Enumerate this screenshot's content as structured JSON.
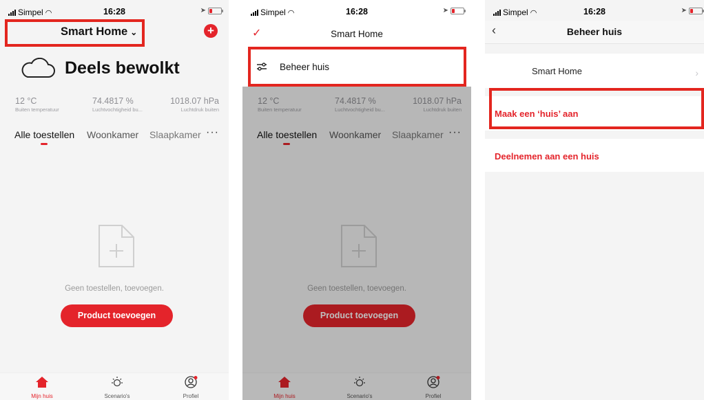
{
  "status_bar": {
    "carrier": "Simpel",
    "time": "16:28"
  },
  "screen1": {
    "home_title": "Smart Home",
    "weather_text": "Deels bewolkt",
    "stats": [
      {
        "value": "12 °C",
        "label": "Buiten temperatuur"
      },
      {
        "value": "74.4817 %",
        "label": "Luchtvochtigheid bu..."
      },
      {
        "value": "1018.07 hPa",
        "label": "Luchtdruk buiten"
      }
    ],
    "tabs": [
      "Alle toestellen",
      "Woonkamer",
      "Slaapkamer"
    ],
    "more_label": "···",
    "empty_text": "Geen toestellen, toevoegen.",
    "add_product": "Product toevoegen",
    "tabbar": [
      "Mijn huis",
      "Scenario's",
      "Profiel"
    ]
  },
  "screen2": {
    "title": "Smart Home",
    "menu_item": "Beheer huis"
  },
  "screen3": {
    "title": "Beheer huis",
    "home_row": "Smart Home",
    "create_home": "Maak een ‘huis’ aan",
    "join_home": "Deelnemen aan een huis"
  },
  "colors": {
    "accent": "#e4242b",
    "highlight_box": "#e3261f"
  },
  "icons": [
    "signal-icon",
    "wifi-icon",
    "location-icon",
    "battery-icon",
    "cloud-icon",
    "plus-icon",
    "chevron-down-icon",
    "check-icon",
    "sliders-icon",
    "back-icon",
    "chevron-right-icon",
    "house-icon",
    "sun-icon",
    "profile-icon",
    "file-add-icon"
  ]
}
